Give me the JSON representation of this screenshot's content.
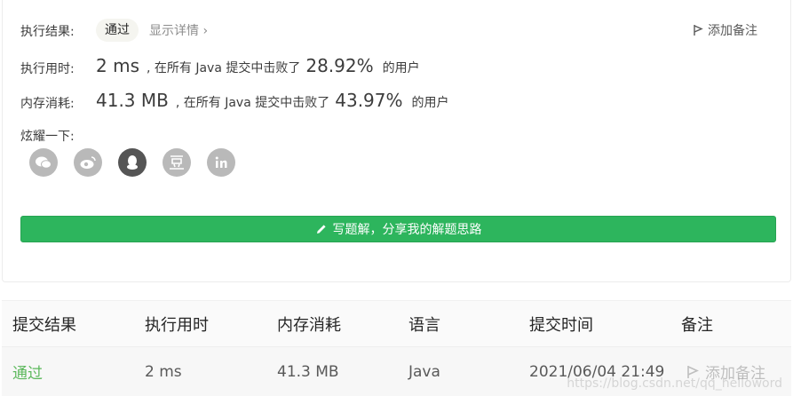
{
  "result": {
    "label": "执行结果:",
    "status": "通过",
    "detail_link": "显示详情",
    "note_link": "添加备注"
  },
  "runtime": {
    "label": "执行用时:",
    "value": "2 ms",
    "mid": ", 在所有 Java 提交中击败了",
    "percent": "28.92%",
    "suffix": "的用户"
  },
  "memory": {
    "label": "内存消耗:",
    "value": "41.3 MB",
    "mid": ", 在所有 Java 提交中击败了",
    "percent": "43.97%",
    "suffix": "的用户"
  },
  "share": {
    "label": "炫耀一下:",
    "icons": [
      "wechat-icon",
      "weibo-icon",
      "qq-icon",
      "douban-icon",
      "linkedin-icon"
    ]
  },
  "write_button": "写题解，分享我的解题思路",
  "table": {
    "headers": [
      "提交结果",
      "执行用时",
      "内存消耗",
      "语言",
      "提交时间",
      "备注"
    ],
    "row": {
      "result": "通过",
      "runtime": "2 ms",
      "memory": "41.3 MB",
      "language": "Java",
      "time": "2021/06/04 21:49",
      "note": "添加备注"
    }
  },
  "watermark": "https://blog.csdn.net/qq_helloword",
  "colors": {
    "accent": "#2db55d",
    "pass": "#5cb85c",
    "icon_bg": "#b9b9b9",
    "icon_active": "#555555"
  }
}
